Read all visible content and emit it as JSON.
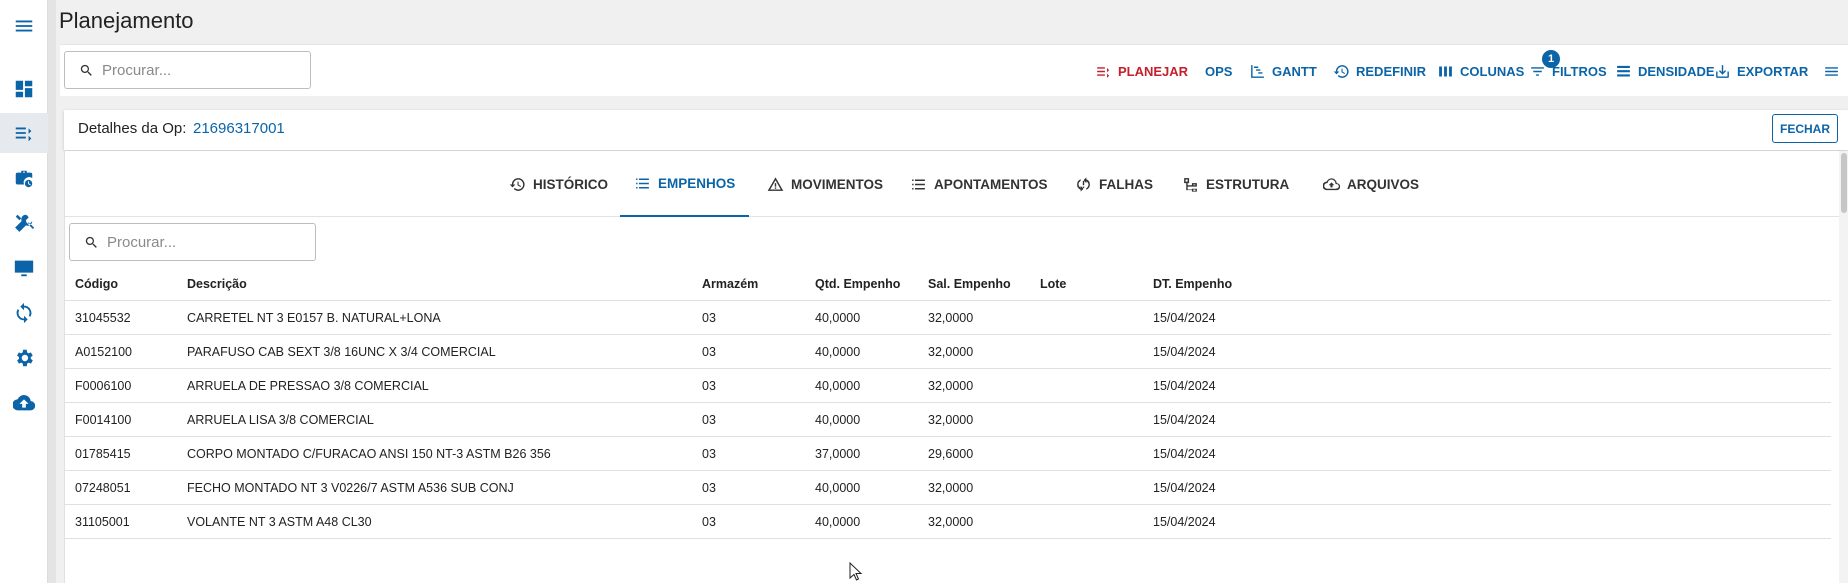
{
  "app": {
    "title": "Planejamento"
  },
  "colors": {
    "accent": "#0b64a8",
    "danger": "#c4202c"
  },
  "sidebar": {
    "items": [
      {
        "icon": "menu-icon"
      },
      {
        "icon": "dashboard-icon"
      },
      {
        "icon": "planning-list-icon"
      },
      {
        "icon": "briefcase-clock-icon"
      },
      {
        "icon": "tools-icon"
      },
      {
        "icon": "monitor-icon"
      },
      {
        "icon": "sync-icon"
      },
      {
        "icon": "gear-icon"
      },
      {
        "icon": "cloud-upload-icon"
      }
    ]
  },
  "toolbar": {
    "search_placeholder": "Procurar...",
    "buttons": {
      "planejar": "PLANEJAR",
      "ops": "OPS",
      "gantt": "GANTT",
      "redefinir": "REDEFINIR",
      "colunas": "COLUNAS",
      "filtros": "FILTROS",
      "filtros_badge": "1",
      "densidade": "DENSIDADE",
      "exportar": "EXPORTAR"
    }
  },
  "details": {
    "label": "Detalhes da Op:",
    "op_number": "21696317001",
    "close_label": "FECHAR"
  },
  "tabs": [
    {
      "label": "HISTÓRICO",
      "icon": "history-icon"
    },
    {
      "label": "EMPENHOS",
      "icon": "list-icon",
      "active": true
    },
    {
      "label": "MOVIMENTOS",
      "icon": "warning-icon"
    },
    {
      "label": "APONTAMENTOS",
      "icon": "checklist-icon"
    },
    {
      "label": "FALHAS",
      "icon": "sync-problem-icon"
    },
    {
      "label": "ESTRUTURA",
      "icon": "hierarchy-icon"
    },
    {
      "label": "ARQUIVOS",
      "icon": "cloud-upload-icon"
    }
  ],
  "grid": {
    "search_placeholder": "Procurar...",
    "columns": [
      "Código",
      "Descrição",
      "Armazém",
      "Qtd. Empenho",
      "Sal. Empenho",
      "Lote",
      "DT. Empenho"
    ],
    "rows": [
      [
        "31045532",
        "CARRETEL NT 3 E0157 B. NATURAL+LONA",
        "03",
        "40,0000",
        "32,0000",
        "",
        "15/04/2024"
      ],
      [
        "A0152100",
        "PARAFUSO CAB SEXT 3/8 16UNC X 3/4 COMERCIAL",
        "03",
        "40,0000",
        "32,0000",
        "",
        "15/04/2024"
      ],
      [
        "F0006100",
        "ARRUELA DE PRESSAO 3/8 COMERCIAL",
        "03",
        "40,0000",
        "32,0000",
        "",
        "15/04/2024"
      ],
      [
        "F0014100",
        "ARRUELA LISA 3/8 COMERCIAL",
        "03",
        "40,0000",
        "32,0000",
        "",
        "15/04/2024"
      ],
      [
        "01785415",
        "CORPO MONTADO C/FURACAO ANSI 150 NT-3 ASTM B26 356",
        "03",
        "37,0000",
        "29,6000",
        "",
        "15/04/2024"
      ],
      [
        "07248051",
        "FECHO MONTADO NT 3 V0226/7 ASTM A536 SUB CONJ",
        "03",
        "40,0000",
        "32,0000",
        "",
        "15/04/2024"
      ],
      [
        "31105001",
        "VOLANTE NT 3 ASTM A48 CL30",
        "03",
        "40,0000",
        "32,0000",
        "",
        "15/04/2024"
      ]
    ]
  }
}
